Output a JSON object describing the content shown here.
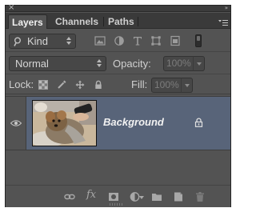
{
  "panel": {
    "close_glyph": "×",
    "collapse_glyph": "»"
  },
  "tabs": [
    {
      "label": "Layers",
      "active": true
    },
    {
      "label": "Channels",
      "active": false
    },
    {
      "label": "Paths",
      "active": false
    }
  ],
  "filter": {
    "kind_label": "Kind",
    "icons": [
      "pixel-layer-filter-icon",
      "adjustment-layer-filter-icon",
      "type-layer-filter-icon",
      "shape-layer-filter-icon",
      "smart-object-filter-icon"
    ]
  },
  "blend": {
    "mode": "Normal",
    "opacity_label": "Opacity:",
    "opacity_value": "100%"
  },
  "lock": {
    "label": "Lock:",
    "icons": [
      "lock-transparent-pixels-icon",
      "lock-image-pixels-icon",
      "lock-position-icon",
      "lock-all-icon"
    ],
    "fill_label": "Fill:",
    "fill_value": "100%"
  },
  "layers": [
    {
      "name": "Background",
      "visible": true,
      "locked": true,
      "selected": true
    }
  ],
  "footer": {
    "icons": [
      "link-layers-icon",
      "layer-style-fx-icon",
      "add-mask-icon",
      "adjustment-layer-icon",
      "new-group-icon",
      "new-layer-icon",
      "delete-layer-icon"
    ],
    "fx_label": "fx"
  },
  "colors": {
    "panel_bg": "#535353",
    "selected_row": "#586479",
    "tab_bar": "#3a3a3a"
  }
}
